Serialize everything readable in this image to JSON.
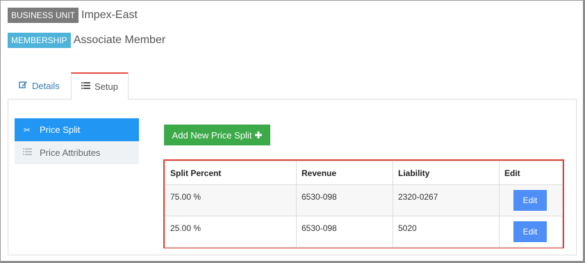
{
  "header": {
    "business_unit_label": "BUSINESS UNIT",
    "business_unit_value": "Impex-East",
    "membership_label": "MEMBERSHIP",
    "membership_value": "Associate Member"
  },
  "tabs": [
    {
      "label": "Details",
      "icon": "edit-icon",
      "active": false
    },
    {
      "label": "Setup",
      "icon": "list-icon",
      "active": true
    }
  ],
  "side_menu": [
    {
      "label": "Price Split",
      "icon": "scissors-icon",
      "active": true
    },
    {
      "label": "Price Attributes",
      "icon": "list-icon",
      "active": false
    }
  ],
  "add_button_label": "Add New Price Split",
  "table": {
    "headers": [
      "Split Percent",
      "Revenue",
      "Liability",
      "Edit"
    ],
    "rows": [
      {
        "split_percent": "75.00 %",
        "revenue": "6530-098",
        "liability": "2320-0267",
        "edit_label": "Edit"
      },
      {
        "split_percent": "25.00 %",
        "revenue": "6530-098",
        "liability": "5020",
        "edit_label": "Edit"
      }
    ]
  },
  "colors": {
    "accent_blue": "#2196f3",
    "add_green": "#3daa4a",
    "edit_blue": "#4f8ef7",
    "highlight_red": "#e0453a",
    "tab_active_top": "#e34b3c"
  }
}
